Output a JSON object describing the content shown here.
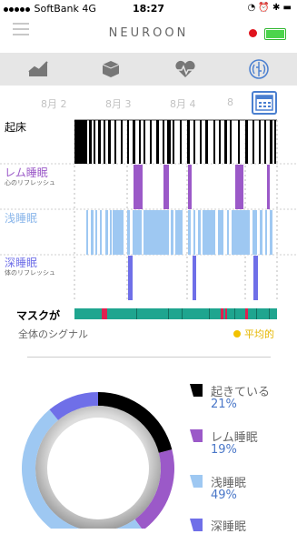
{
  "status": {
    "carrier": "SoftBank",
    "network": "4G",
    "time": "18:27"
  },
  "header": {
    "logo": "NEUROON"
  },
  "tabs": [
    {
      "icon": "chart-icon",
      "active": false
    },
    {
      "icon": "cube-icon",
      "active": false
    },
    {
      "icon": "heart-pulse-icon",
      "active": false
    },
    {
      "icon": "brain-icon",
      "active": true
    }
  ],
  "dates": [
    "8月 2",
    "8月 3",
    "8月 4",
    "8"
  ],
  "rows": {
    "wake": {
      "label": "起床"
    },
    "rem": {
      "label": "レム睡眠",
      "sub": "心のリフレッシュ"
    },
    "light": {
      "label": "浅睡眠"
    },
    "deep": {
      "label": "深睡眠",
      "sub": "体のリフレッシュ"
    },
    "mask": {
      "label": "マスクが"
    }
  },
  "signal": {
    "label": "全体のシグナル",
    "status": "平均的"
  },
  "colors": {
    "wake": "#000000",
    "rem": "#9b59c8",
    "light": "#9ec8f2",
    "deep": "#6f6fe8",
    "mask": "#1fa58f",
    "mask_bad": "#e02050"
  },
  "legend": [
    {
      "name": "起きている",
      "percent": "21%",
      "color": "#000000"
    },
    {
      "name": "レム睡眠",
      "percent": "19%",
      "color": "#9b59c8"
    },
    {
      "name": "浅睡眠",
      "percent": "49%",
      "color": "#9ec8f2"
    },
    {
      "name": "深睡眠",
      "percent": "",
      "color": "#6f6fe8"
    }
  ]
}
